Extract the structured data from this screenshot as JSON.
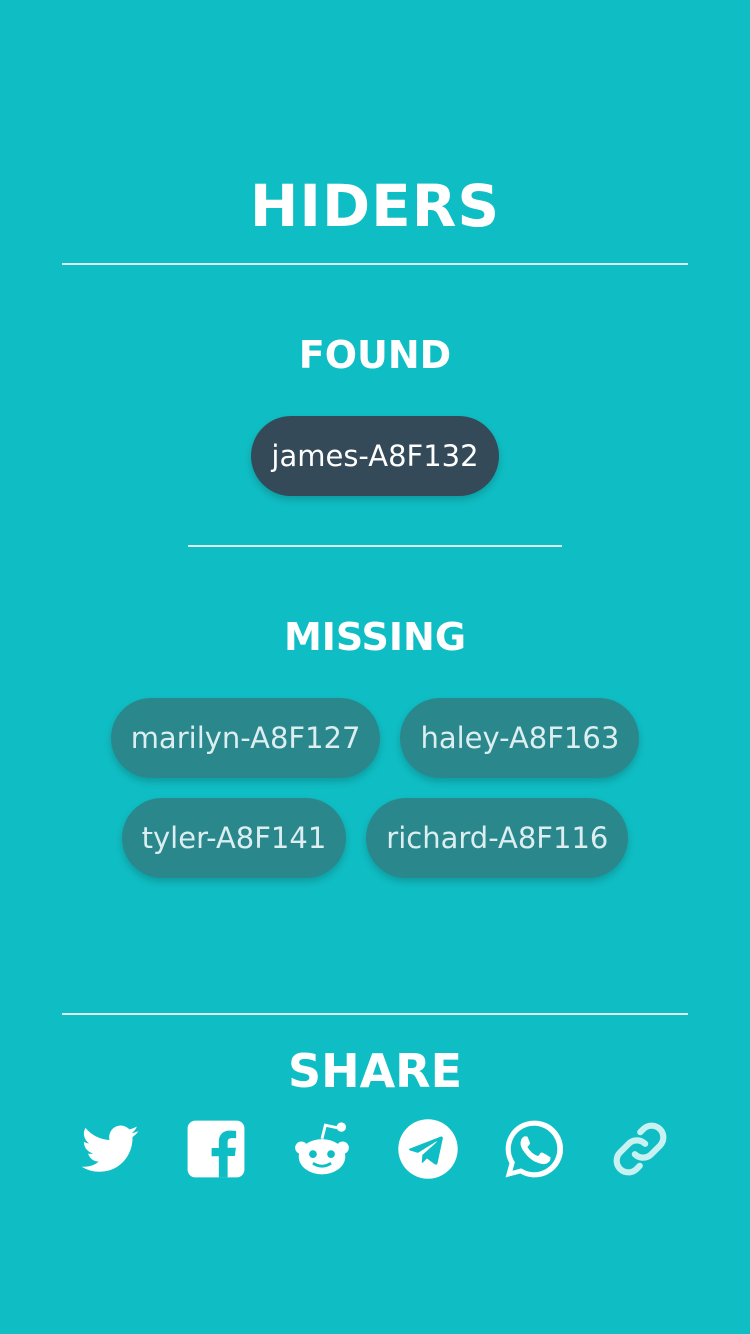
{
  "header": {
    "title": "HIDERS"
  },
  "found": {
    "title": "FOUND",
    "players": [
      "james-A8F132"
    ]
  },
  "missing": {
    "title": "MISSING",
    "players": [
      "marilyn-A8F127",
      "haley-A8F163",
      "tyler-A8F141",
      "richard-A8F116"
    ]
  },
  "share": {
    "title": "SHARE",
    "icons": [
      "twitter-icon",
      "facebook-icon",
      "reddit-icon",
      "telegram-icon",
      "whatsapp-icon",
      "link-icon"
    ]
  },
  "colors": {
    "background": "#0fbec4",
    "found_chip": "#344a58",
    "missing_chip": "#2a888d",
    "text": "#ffffff"
  }
}
